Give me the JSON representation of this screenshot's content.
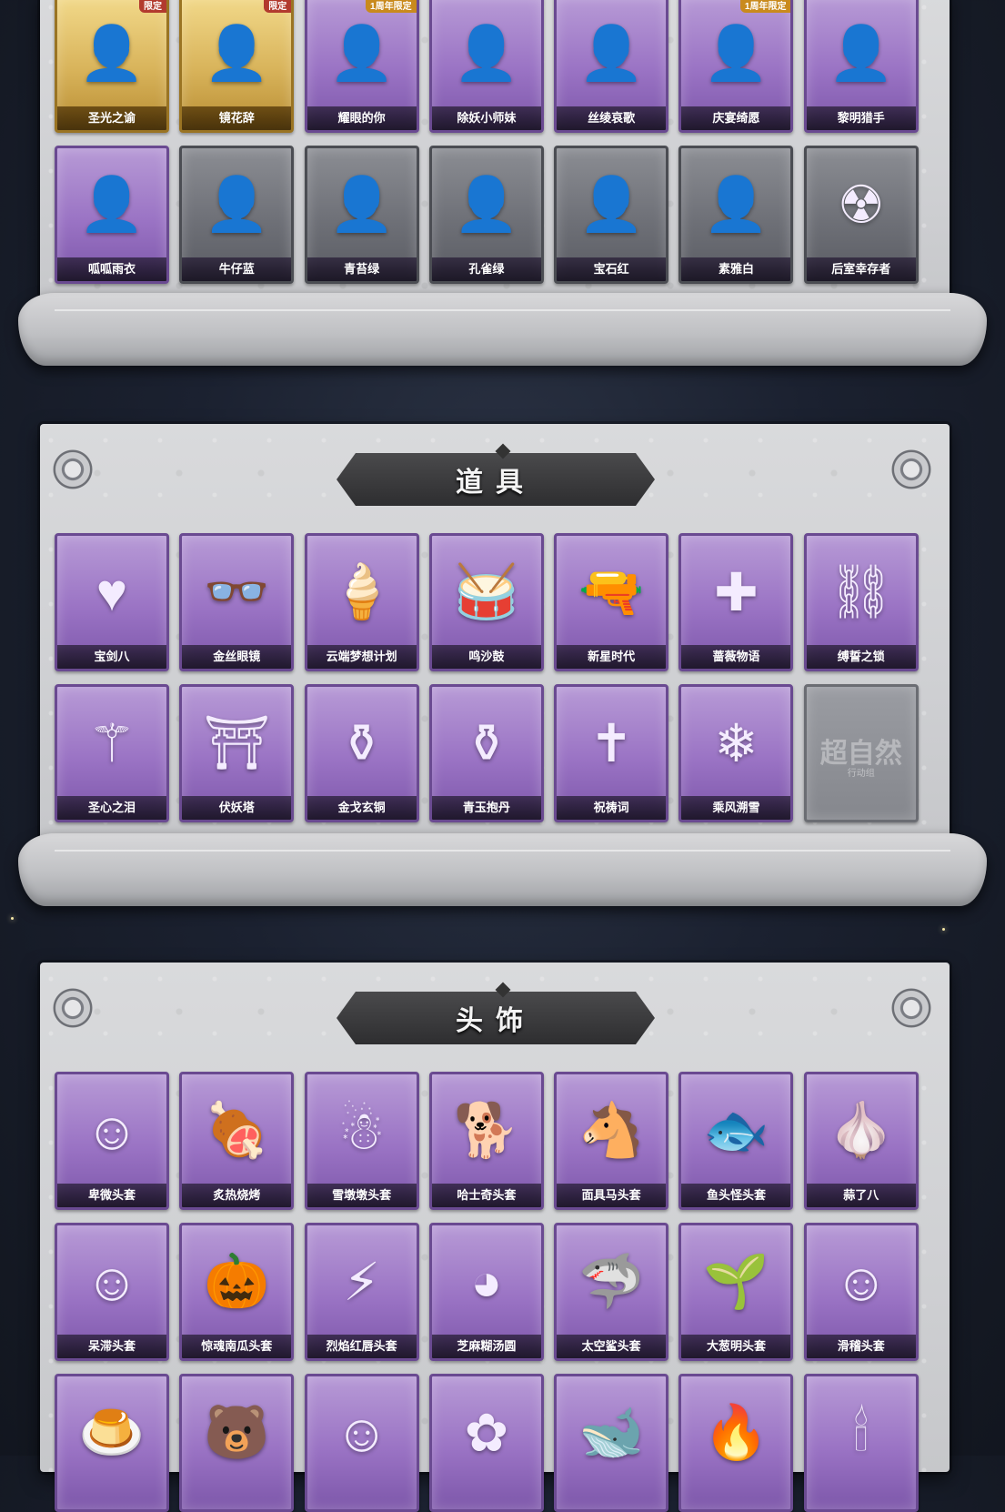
{
  "sections": [
    {
      "title": "",
      "items": [
        {
          "label": "圣光之谕",
          "badge": "限定",
          "style": "gold",
          "icon": "portrait-icon"
        },
        {
          "label": "镜花辞",
          "badge": "限定",
          "style": "gold",
          "icon": "portrait-icon"
        },
        {
          "label": "耀眼的你",
          "badge": "1周年限定",
          "style": "purple",
          "icon": "portrait-icon"
        },
        {
          "label": "除妖小师妹",
          "badge": "",
          "style": "purple",
          "icon": "portrait-icon"
        },
        {
          "label": "丝绫哀歌",
          "badge": "",
          "style": "purple",
          "icon": "portrait-icon"
        },
        {
          "label": "庆宴绮愿",
          "badge": "1周年限定",
          "style": "purple",
          "icon": "portrait-icon"
        },
        {
          "label": "黎明猎手",
          "badge": "",
          "style": "purple",
          "icon": "portrait-icon"
        },
        {
          "label": "呱呱雨衣",
          "badge": "",
          "style": "purple",
          "icon": "portrait-icon"
        },
        {
          "label": "牛仔蓝",
          "badge": "",
          "style": "grey",
          "icon": "portrait-icon"
        },
        {
          "label": "青苔绿",
          "badge": "",
          "style": "grey",
          "icon": "portrait-icon"
        },
        {
          "label": "孔雀绿",
          "badge": "",
          "style": "grey",
          "icon": "portrait-icon"
        },
        {
          "label": "宝石红",
          "badge": "",
          "style": "grey",
          "icon": "portrait-icon"
        },
        {
          "label": "素雅白",
          "badge": "",
          "style": "grey",
          "icon": "portrait-icon"
        },
        {
          "label": "后室幸存者",
          "badge": "",
          "style": "grey",
          "icon": "hazmat-icon"
        }
      ]
    },
    {
      "title": "道具",
      "items": [
        {
          "label": "宝剑八",
          "badge": "",
          "style": "purple",
          "icon": "heart-shield-icon"
        },
        {
          "label": "金丝眼镜",
          "badge": "",
          "style": "purple",
          "icon": "glasses-icon"
        },
        {
          "label": "云端梦想计划",
          "badge": "",
          "style": "purple",
          "icon": "popsicle-icon"
        },
        {
          "label": "鸣沙鼓",
          "badge": "",
          "style": "purple",
          "icon": "drum-icon"
        },
        {
          "label": "新星时代",
          "badge": "",
          "style": "purple",
          "icon": "revolver-icon"
        },
        {
          "label": "蔷薇物语",
          "badge": "",
          "style": "purple",
          "icon": "medkit-icon"
        },
        {
          "label": "缚誓之锁",
          "badge": "",
          "style": "purple",
          "icon": "chain-icon"
        },
        {
          "label": "圣心之泪",
          "badge": "",
          "style": "purple",
          "icon": "scepter-icon"
        },
        {
          "label": "伏妖塔",
          "badge": "",
          "style": "purple",
          "icon": "pagoda-icon"
        },
        {
          "label": "金戈玄铜",
          "badge": "",
          "style": "purple",
          "icon": "bronze-icon"
        },
        {
          "label": "青玉抱丹",
          "badge": "",
          "style": "purple",
          "icon": "vase-icon"
        },
        {
          "label": "祝祷词",
          "badge": "",
          "style": "purple",
          "icon": "cross-icon"
        },
        {
          "label": "乘风溯雪",
          "badge": "",
          "style": "purple",
          "icon": "snow-device-icon"
        },
        {
          "label": "",
          "badge": "",
          "style": "empty",
          "icon": "placeholder-logo-icon",
          "watermark": "超自然",
          "watermark_sub": "行动组"
        }
      ]
    },
    {
      "title": "头饰",
      "items": [
        {
          "label": "卑微头套",
          "badge": "",
          "style": "purple",
          "icon": "emoji-face-icon"
        },
        {
          "label": "炙热烧烤",
          "badge": "",
          "style": "purple",
          "icon": "bbq-icon"
        },
        {
          "label": "雪墩墩头套",
          "badge": "",
          "style": "purple",
          "icon": "snowman-icon"
        },
        {
          "label": "哈士奇头套",
          "badge": "",
          "style": "purple",
          "icon": "dog-icon"
        },
        {
          "label": "面具马头套",
          "badge": "",
          "style": "purple",
          "icon": "horse-icon"
        },
        {
          "label": "鱼头怪头套",
          "badge": "",
          "style": "purple",
          "icon": "fish-icon"
        },
        {
          "label": "蒜了八",
          "badge": "",
          "style": "purple",
          "icon": "garlic-icon"
        },
        {
          "label": "呆滞头套",
          "badge": "",
          "style": "purple",
          "icon": "emoji-face-icon"
        },
        {
          "label": "惊魂南瓜头套",
          "badge": "",
          "style": "purple",
          "icon": "pumpkin-icon"
        },
        {
          "label": "烈焰红唇头套",
          "badge": "",
          "style": "purple",
          "icon": "pikachu-icon"
        },
        {
          "label": "芝麻糊汤圆",
          "badge": "",
          "style": "purple",
          "icon": "dumpling-icon"
        },
        {
          "label": "太空鲨头套",
          "badge": "",
          "style": "purple",
          "icon": "shark-icon"
        },
        {
          "label": "大葱明头套",
          "badge": "",
          "style": "purple",
          "icon": "leek-icon"
        },
        {
          "label": "滑稽头套",
          "badge": "",
          "style": "purple",
          "icon": "emoji-face-icon"
        },
        {
          "label": "",
          "badge": "",
          "style": "purple",
          "icon": "pudding-icon"
        },
        {
          "label": "",
          "badge": "",
          "style": "purple",
          "icon": "bear-icon"
        },
        {
          "label": "",
          "badge": "",
          "style": "purple",
          "icon": "emoji-face-icon"
        },
        {
          "label": "",
          "badge": "",
          "style": "purple",
          "icon": "pink-creature-icon"
        },
        {
          "label": "",
          "badge": "",
          "style": "purple",
          "icon": "whale-icon"
        },
        {
          "label": "",
          "badge": "",
          "style": "purple",
          "icon": "fire-icon"
        },
        {
          "label": "",
          "badge": "",
          "style": "purple",
          "icon": "candle-icon"
        }
      ]
    }
  ]
}
